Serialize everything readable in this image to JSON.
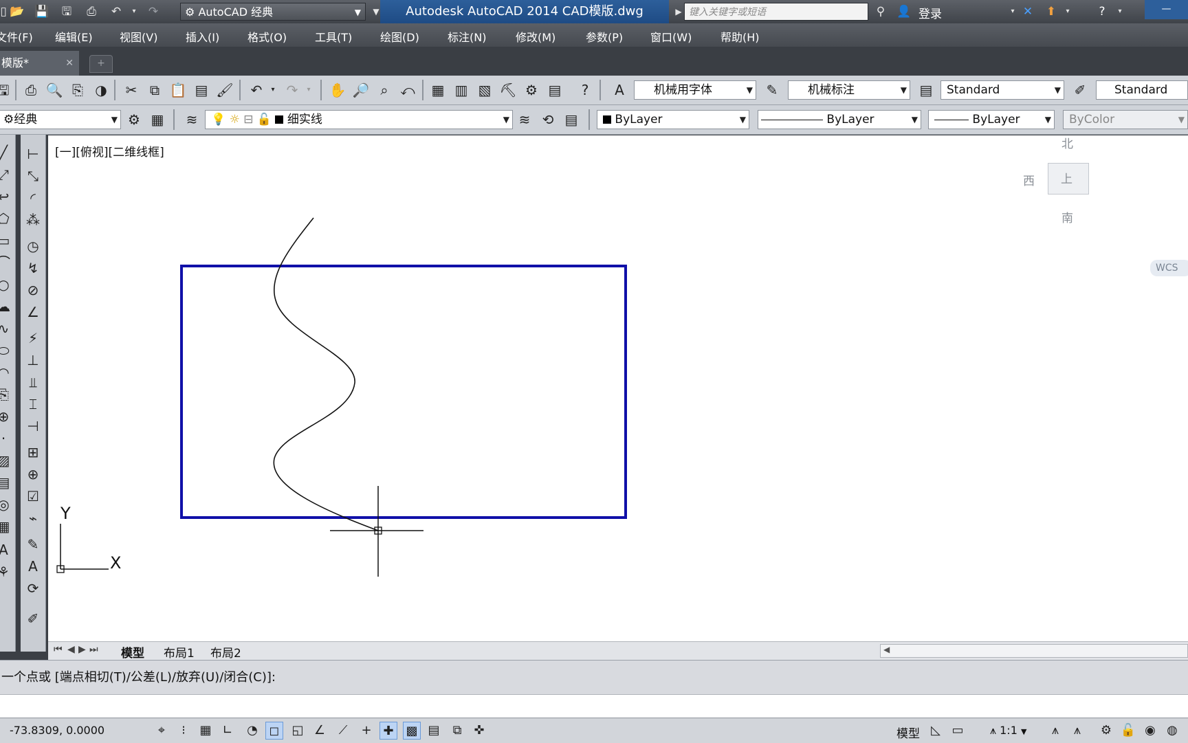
{
  "app": {
    "workspace": "AutoCAD 经典",
    "title": "Autodesk AutoCAD 2014    CAD模版.dwg",
    "search_placeholder": "键入关键字或短语",
    "login": "登录"
  },
  "menu": [
    "文件(F)",
    "编辑(E)",
    "视图(V)",
    "插入(I)",
    "格式(O)",
    "工具(T)",
    "绘图(D)",
    "标注(N)",
    "修改(M)",
    "参数(P)",
    "窗口(W)",
    "帮助(H)"
  ],
  "doc_tab": {
    "label": "模版*"
  },
  "styles": {
    "text_style": "机械用字体",
    "dim_style": "机械标注",
    "table_style": "Standard",
    "mleader_style": "Standard"
  },
  "layers": {
    "workspace_combo": "经典",
    "current_layer": "细实线",
    "color": "ByLayer",
    "linetype": "ByLayer",
    "lineweight": "ByLayer",
    "plotstyle": "ByColor"
  },
  "canvas": {
    "viewport_label": "[一][俯视][二维线框]",
    "ucs_x": "X",
    "ucs_y": "Y",
    "rect_color": "#1010a8"
  },
  "viewcube": {
    "north": "北",
    "west": "西",
    "south": "南",
    "top": "上",
    "wcs": "WCS"
  },
  "layout_tabs": [
    "模型",
    "布局1",
    "布局2"
  ],
  "command_line": "一个点或 [端点相切(T)/公差(L)/放弃(U)/闭合(C)]:",
  "status": {
    "coords": "-73.8309, 0.0000",
    "model_label": "模型",
    "scale": "1:1"
  },
  "colors": {
    "accent": "#1e4b84",
    "toolbar": "#cfd3d9",
    "canvas": "#ffffff"
  }
}
